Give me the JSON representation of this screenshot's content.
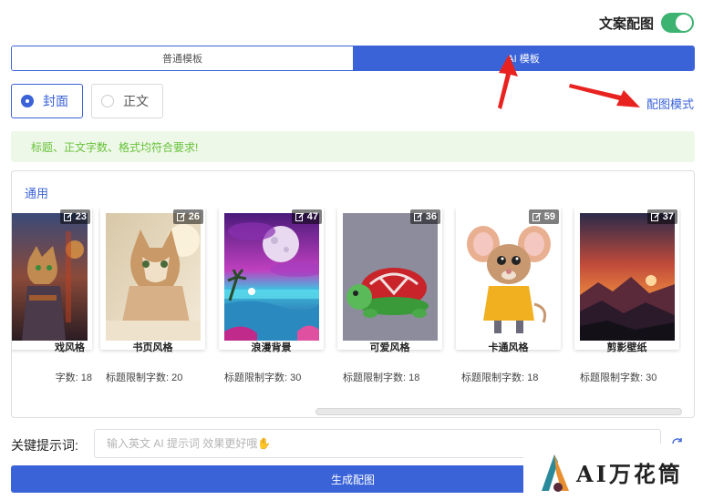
{
  "header": {
    "toggle_label": "文案配图",
    "toggle_on": true
  },
  "tabs": [
    {
      "label": "普通模板",
      "active": false
    },
    {
      "label": "AI 模板",
      "active": true
    }
  ],
  "radios": [
    {
      "label": "封面",
      "selected": true
    },
    {
      "label": "正文",
      "selected": false
    }
  ],
  "mode_link": "配图模式",
  "alert": {
    "text": "标题、正文字数、格式均符合要求!"
  },
  "template_panel": {
    "category": "通用",
    "cards": [
      {
        "name": "游戏风格",
        "badge": "23",
        "limit_label": "标题限制字数:",
        "limit": "18",
        "visible_name": "戏风格",
        "visible_limit_label": "字数:"
      },
      {
        "name": "书页风格",
        "badge": "26",
        "limit_label": "标题限制字数:",
        "limit": "20"
      },
      {
        "name": "浪漫背景",
        "badge": "47",
        "limit_label": "标题限制字数:",
        "limit": "30"
      },
      {
        "name": "可爱风格",
        "badge": "36",
        "limit_label": "标题限制字数:",
        "limit": "18"
      },
      {
        "name": "卡通风格",
        "badge": "59",
        "limit_label": "标题限制字数:",
        "limit": "18"
      },
      {
        "name": "剪影壁纸",
        "badge": "37",
        "limit_label": "标题限制字数:",
        "limit": "30"
      }
    ]
  },
  "keyword": {
    "label": "关键提示词:",
    "placeholder": "输入英文 AI 提示词 效果更好哦✋",
    "value": ""
  },
  "generate_button": "生成配图",
  "watermark": {
    "text": "AI万花筒"
  },
  "colors": {
    "accent": "#3b63d8",
    "success": "#67c23a",
    "switch_on": "#3cb371",
    "arrow": "#e8221f"
  }
}
